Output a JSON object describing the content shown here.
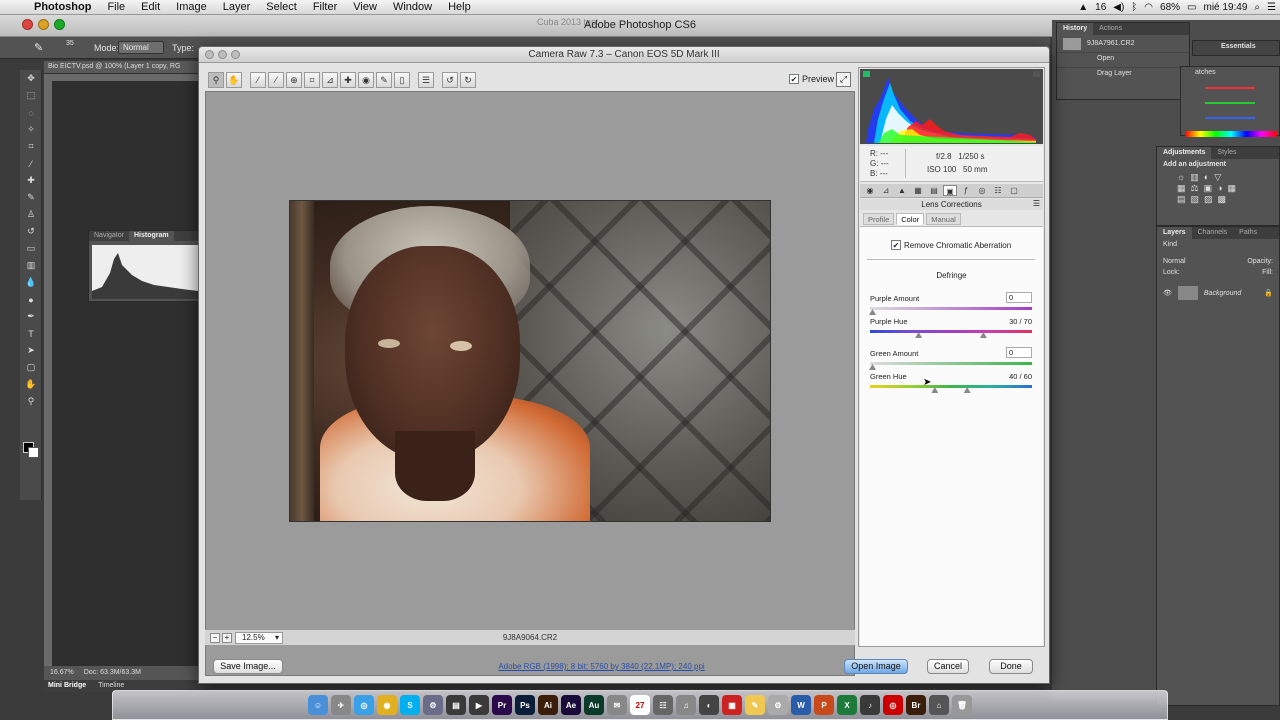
{
  "menubar": {
    "app": "Photoshop",
    "items": [
      "File",
      "Edit",
      "Image",
      "Layer",
      "Select",
      "Filter",
      "View",
      "Window",
      "Help"
    ],
    "right": {
      "clock_day": "16",
      "battery": "68%",
      "datetime": "mié 19:49"
    }
  },
  "ps": {
    "title": "Adobe Photoshop CS6",
    "ghost_title": "Cuba 2013 test",
    "options": {
      "mode_label": "Mode:",
      "mode_value": "Normal",
      "type_label": "Type:",
      "brush_size": "35"
    },
    "doc_tab": "Bio EICTV.psd @ 100% (Layer 1 copy, RG",
    "status": {
      "zoom": "16.67%",
      "doc": "Doc: 63.3M/63.3M"
    },
    "bottom_tabs": [
      "Mini Bridge",
      "Timeline"
    ],
    "nav_tabs": [
      "Navigator",
      "Histogram"
    ],
    "history": {
      "tabs": [
        "History",
        "Actions"
      ],
      "snapshot": "9J8A7961.CR2",
      "items": [
        "Open",
        "Drag Layer"
      ]
    },
    "workspace": "Essentials",
    "swatches_tab": "atches",
    "adjustments": {
      "tabs": [
        "Adjustments",
        "Styles"
      ],
      "hint": "Add an adjustment"
    },
    "layers": {
      "tabs": [
        "Layers",
        "Channels",
        "Paths"
      ],
      "kind": "Kind",
      "blend": "Normal",
      "opacity": "Opacity:",
      "lock": "Lock:",
      "fill": "Fill:",
      "layer_name": "Background"
    }
  },
  "camera_raw": {
    "title": "Camera Raw 7.3  –  Canon EOS 5D Mark III",
    "preview_label": "Preview",
    "preview_checked": true,
    "zoom": "12.5%",
    "filename": "9J8A9064.CR2",
    "info": {
      "r": "R:",
      "g": "G:",
      "b": "B:",
      "dash": "---",
      "aperture": "f/2.8",
      "shutter": "1/250 s",
      "iso": "ISO 100",
      "focal": "50 mm"
    },
    "panel_title": "Lens Corrections",
    "subtabs": [
      "Profile",
      "Color",
      "Manual"
    ],
    "active_subtab": "Color",
    "remove_ca": {
      "label": "Remove Chromatic Aberration",
      "checked": true
    },
    "defringe": {
      "heading": "Defringe",
      "purple_amount": {
        "label": "Purple Amount",
        "value": "0",
        "amount": 0
      },
      "purple_hue": {
        "label": "Purple Hue",
        "value": "30 / 70",
        "low": 30,
        "high": 70
      },
      "green_amount": {
        "label": "Green Amount",
        "value": "0",
        "amount": 0
      },
      "green_hue": {
        "label": "Green Hue",
        "value": "40 / 60",
        "low": 40,
        "high": 60
      }
    },
    "buttons": {
      "save": "Save Image...",
      "open": "Open Image",
      "cancel": "Cancel",
      "done": "Done"
    },
    "workflow": "Adobe RGB (1998); 8 bit; 5760 by 3840 (22.1MP); 240 ppi"
  },
  "dock": {
    "apps": [
      "Finder",
      "Safari",
      "Chrome",
      "Skype",
      "Pr",
      "Ps",
      "Ai",
      "Ae",
      "Au",
      "Br",
      "W",
      "P",
      "X"
    ]
  },
  "colors": {
    "default_button": "#6fa9e6",
    "purple": "#a13cc9",
    "green": "#3ab54a",
    "link": "#2a4fa8"
  }
}
